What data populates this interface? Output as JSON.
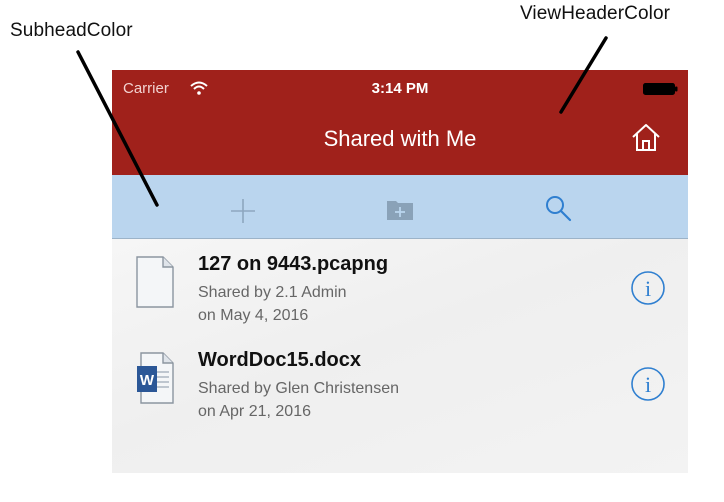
{
  "annotations": {
    "subhead": "SubheadColor",
    "view_header": "ViewHeaderColor"
  },
  "status_bar": {
    "carrier": "Carrier",
    "time": "3:14 PM",
    "wifi_icon": "wifi-icon",
    "battery_icon": "battery-icon"
  },
  "header": {
    "title": "Shared with Me",
    "home_icon": "home-icon",
    "color": "#a0211b"
  },
  "subhead": {
    "color": "#bad5ee",
    "buttons": [
      {
        "icon": "plus-icon",
        "action": "add"
      },
      {
        "icon": "new-folder-icon",
        "action": "new-folder"
      },
      {
        "icon": "search-icon",
        "action": "search"
      }
    ]
  },
  "files": [
    {
      "name": "127 on 9443.pcapng",
      "shared_by": "Shared by 2.1 Admin",
      "date": "on May 4, 2016",
      "icon": "generic-file-icon"
    },
    {
      "name": "WordDoc15.docx",
      "shared_by": "Shared by Glen Christensen",
      "date": "on Apr 21, 2016",
      "icon": "word-doc-icon"
    }
  ],
  "colors": {
    "accent_blue": "#2f7fd0"
  }
}
